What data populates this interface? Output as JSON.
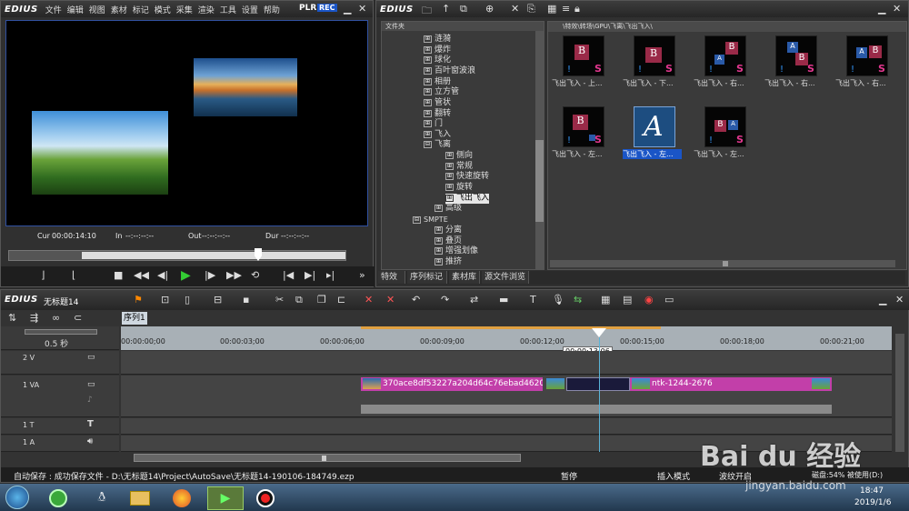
{
  "player": {
    "logo": "EDIUS",
    "menu": [
      "文件",
      "编辑",
      "视图",
      "素材",
      "标记",
      "模式",
      "采集",
      "渲染",
      "工具",
      "设置",
      "帮助"
    ],
    "plr": "PLR",
    "rec": "REC",
    "timecodes": {
      "cur_label": "Cur",
      "cur": "00:00:14:10",
      "in_label": "In",
      "in": "--:--:--:--",
      "out_label": "Out",
      "out": "--:--:--:--",
      "dur_label": "Dur",
      "dur": "--:--:--:--"
    }
  },
  "bin": {
    "logo": "EDIUS",
    "folder_header": "文件夹",
    "path": "\\特效\\转场\\GPU\\飞离\\飞出飞入\\",
    "tree": [
      "涟漪",
      "爆炸",
      "球化",
      "百叶窗波浪",
      "相册",
      "立方管",
      "管状",
      "翻转",
      "门",
      "飞入",
      "飞离",
      "侧向",
      "常规",
      "快速旋转",
      "旋转",
      "飞出飞入",
      "高级",
      "SMPTE",
      "分离",
      "叠页",
      "增强划像",
      "推挤"
    ],
    "thumbs": [
      "飞出飞入 - 上...",
      "飞出飞入 - 下...",
      "飞出飞入 - 右...",
      "飞出飞入 - 右...",
      "飞出飞入 - 右...",
      "飞出飞入 - 左...",
      "飞出飞入 - 左...",
      "飞出飞入 - 左..."
    ],
    "tabs": [
      "特效",
      "序列标记",
      "素材库",
      "源文件浏览"
    ]
  },
  "timeline": {
    "logo": "EDIUS",
    "project": "无标题14",
    "sequence": "序列1",
    "zoom": "0.5 秒",
    "ruler": [
      "00:00:00;00",
      "00:00:03;00",
      "00:00:06;00",
      "00:00:09;00",
      "00:00:12;00",
      "00:00:15;00",
      "00:00:18;00",
      "00:00:21;00"
    ],
    "playhead_tc": "00:00:13:06",
    "tracks": [
      {
        "name": "2 V"
      },
      {
        "name": "1 VA"
      },
      {
        "name": "1 T"
      },
      {
        "name": "1 A"
      }
    ],
    "clips": [
      "370ace8df53227a204d64c76ebad4620",
      "ntk-1244-2676"
    ]
  },
  "status": {
    "autosave": "自动保存 : 成功保存文件 - D:\\无标题14\\Project\\AutoSave\\无标题14-190106-184749.ezp",
    "pause": "暂停",
    "insert": "插入模式",
    "ripple": "波纹开启",
    "disk": "磁盘:54% 被使用(D:)"
  },
  "taskbar": {
    "time": "18:47",
    "date": "2019/1/6"
  },
  "watermark": {
    "brand": "Bai du 经验",
    "url": "jingyan.baidu.com"
  },
  "colors": {
    "accent": "#1a55c7",
    "clip": "#c23fa9",
    "playhead": "#5ab4d8"
  }
}
